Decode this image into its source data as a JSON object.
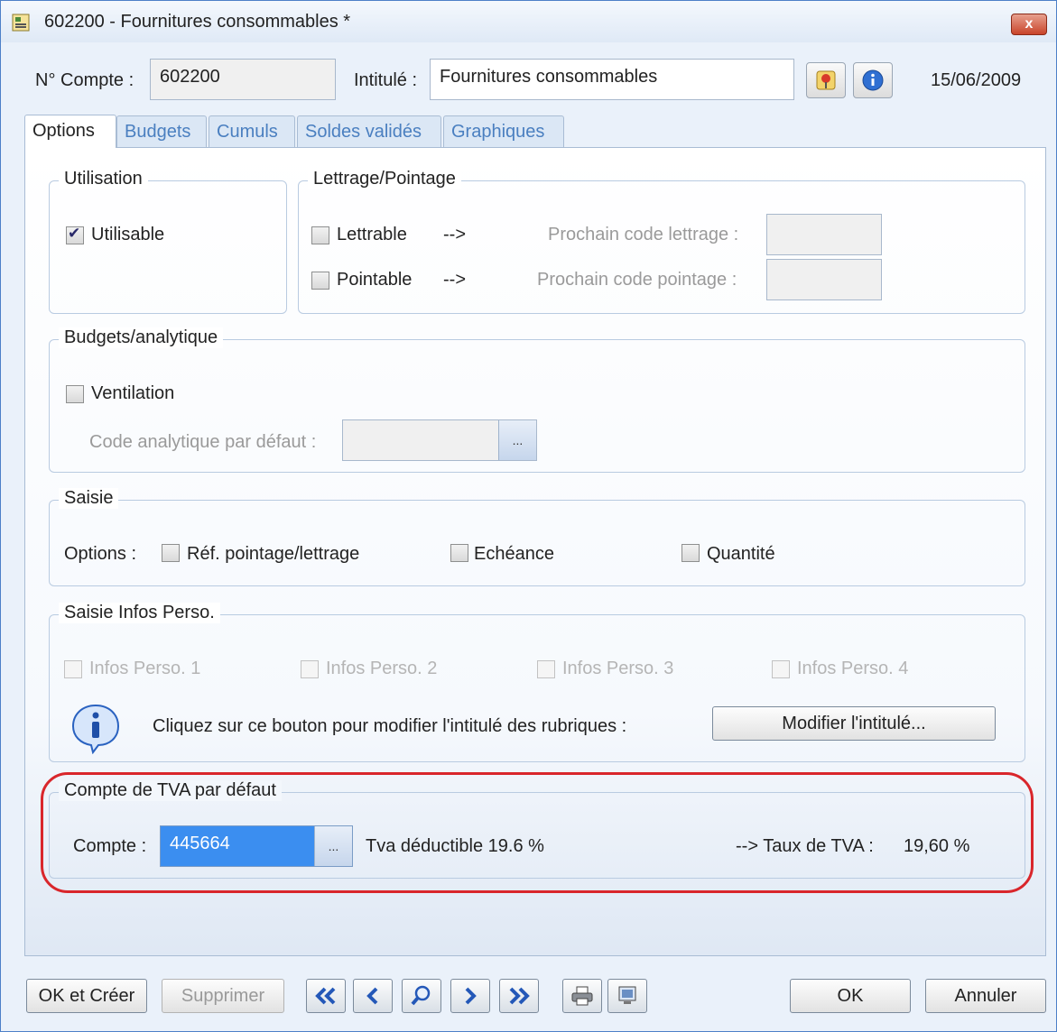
{
  "window": {
    "title": "602200 - Fournitures consommables *",
    "close_label": "x"
  },
  "header": {
    "compte_label": "N° Compte :",
    "compte_value": "602200",
    "intitule_label": "Intitulé :",
    "intitule_value": "Fournitures consommables",
    "date": "15/06/2009"
  },
  "tabs": [
    {
      "label": "Options",
      "active": true
    },
    {
      "label": "Budgets"
    },
    {
      "label": "Cumuls"
    },
    {
      "label": "Soldes validés"
    },
    {
      "label": "Graphiques"
    }
  ],
  "utilisation": {
    "legend": "Utilisation",
    "utilisable_label": "Utilisable",
    "utilisable_checked": true
  },
  "lettrage": {
    "legend": "Lettrage/Pointage",
    "lettrable_label": "Lettrable",
    "pointable_label": "Pointable",
    "arrow": "-->",
    "prochain_lettrage_label": "Prochain code lettrage :",
    "prochain_pointage_label": "Prochain code pointage :"
  },
  "budgets": {
    "legend": "Budgets/analytique",
    "ventilation_label": "Ventilation",
    "code_label": "Code analytique par défaut :",
    "ellipsis": "..."
  },
  "saisie": {
    "legend": "Saisie",
    "options_label": "Options :",
    "ref_label": "Réf. pointage/lettrage",
    "echeance_label": "Echéance",
    "quantite_label": "Quantité"
  },
  "infos": {
    "legend": "Saisie Infos Perso.",
    "items": [
      "Infos Perso. 1",
      "Infos Perso. 2",
      "Infos Perso. 3",
      "Infos Perso. 4"
    ],
    "hint": "Cliquez sur ce bouton pour modifier l'intitulé des rubriques :",
    "button": "Modifier l'intitulé..."
  },
  "tva": {
    "legend": "Compte de TVA par défaut",
    "compte_label": "Compte :",
    "compte_value": "445664",
    "ellipsis": "...",
    "description": "Tva déductible 19.6 %",
    "taux_label": "--> Taux de TVA :",
    "taux_value": "19,60 %"
  },
  "footer": {
    "ok_creer": "OK et Créer",
    "supprimer": "Supprimer",
    "ok": "OK",
    "annuler": "Annuler"
  },
  "colors": {
    "accent": "#3b83e0",
    "highlight_oval": "#d9262b",
    "selection": "#3b8ef0"
  }
}
